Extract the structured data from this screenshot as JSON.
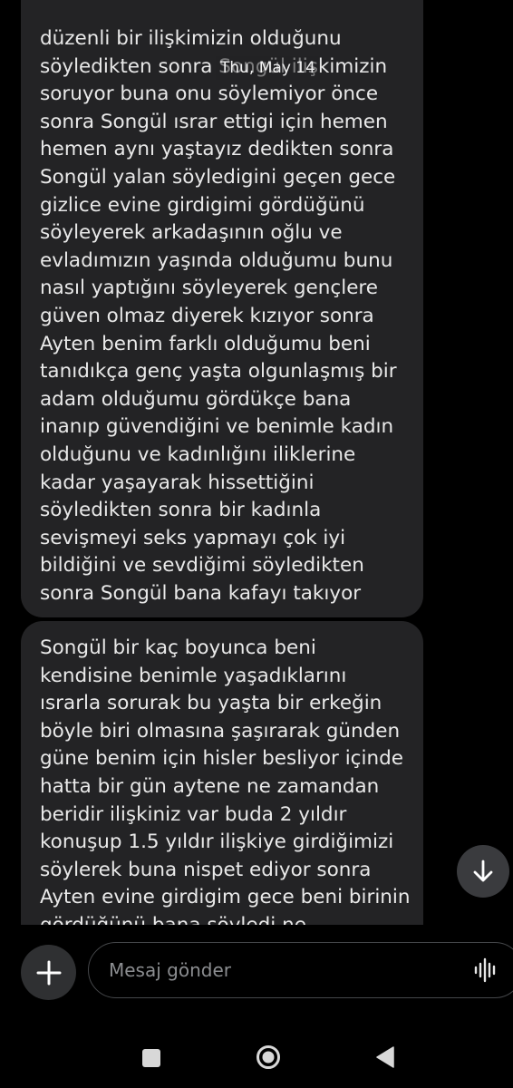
{
  "conversation": {
    "date_separator": "Thu, May 14",
    "messages": [
      {
        "lines": [
          "düzenli bir ilişkimizin olduğunu",
          "söyledikten sonra Songül ilişkimizin",
          "soruyor buna onu söylemiyor önce",
          "sonra Songül ısrar ettigi için hemen",
          "hemen aynı yaştayız dedikten sonra",
          "Songül yalan söyledigini geçen gece",
          "gizlice evine girdigimi gördüğünü",
          "söyleyerek arkadaşının oğlu ve",
          "evladımızın yaşında olduğumu bunu",
          "nasıl yaptığını söyleyerek gençlere",
          "güven olmaz diyerek kızıyor sonra",
          "Ayten benim farklı olduğumu beni",
          "tanıdıkça genç yaşta olgunlaşmış bir",
          "adam olduğumu gördükçe bana",
          "inanıp güvendiğini ve benimle kadın",
          "olduğunu ve kadınlığını iliklerine",
          "kadar yaşayarak hissettiğini",
          "söyledikten sonra bir kadınla",
          "sevişmeyi seks yapmayı çok iyi",
          "bildiğini ve sevdiğimi söyledikten",
          "sonra Songül bana kafayı takıyor"
        ]
      },
      {
        "lines": [
          "Songül bir kaç boyunca beni",
          "kendisine benimle yaşadıklarını",
          "ısrarla sorurak bu yaşta bir erkeğin",
          "böyle biri olmasına şaşırarak günden",
          "güne benim için hisler besliyor içinde",
          "hatta bir gün aytene ne zamandan",
          "beridir ilişkiniz var buda 2 yıldır",
          "konuşup 1.5 yıldır ilişkiye girdiğimizi",
          "söylerek buna nispet ediyor sonra",
          "Ayten evine girdigim gece beni birinin",
          "gördüğünü bana söyledi ne"
        ]
      }
    ]
  },
  "composer": {
    "placeholder": "Mesaj gönder",
    "add_icon": "plus-icon",
    "voice_icon": "voice-waveform-icon"
  },
  "scroll_button_icon": "arrow-down-icon",
  "navigation": {
    "recent_icon": "recent-apps-square-icon",
    "home_icon": "home-circle-icon",
    "back_icon": "back-triangle-icon"
  },
  "colors": {
    "background": "#000000",
    "bubble": "#232325",
    "text": "#e9e9e9",
    "placeholder": "#8b8d90"
  }
}
